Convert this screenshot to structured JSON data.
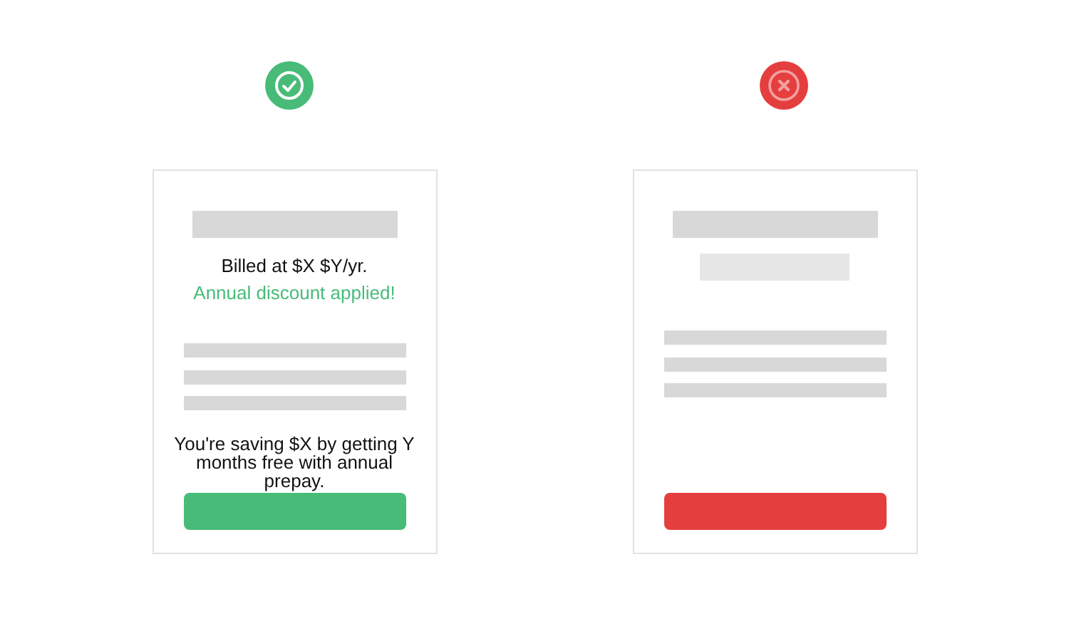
{
  "examples": [
    {
      "kind": "good",
      "color": "#48bb78",
      "billing": "Billed at $X $Y/yr.",
      "discount": "Annual discount applied!",
      "saving": "You're saving $X by getting Y months free with annual prepay."
    },
    {
      "kind": "bad",
      "color": "#e53e3e"
    }
  ]
}
